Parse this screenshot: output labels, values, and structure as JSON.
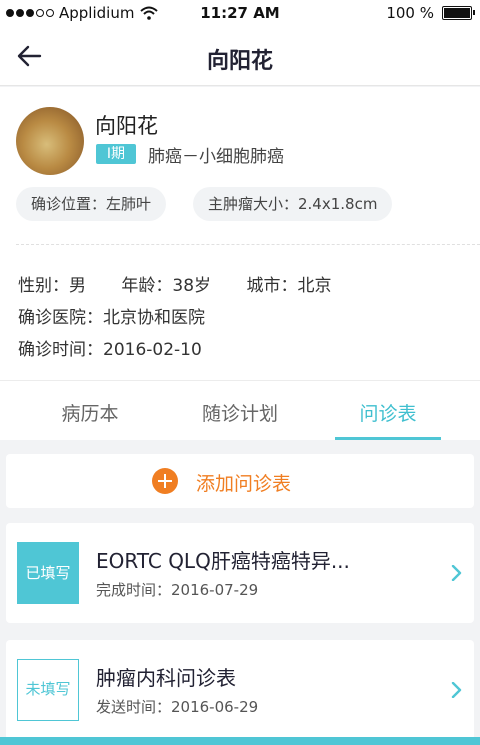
{
  "status": {
    "carrier": "Applidium",
    "time": "11:27 AM",
    "battery": "100 %"
  },
  "nav": {
    "title": "向阳花"
  },
  "patient": {
    "name": "向阳花",
    "stage": "I期",
    "diagnosis": "肺癌－小细胞肺癌",
    "chips": [
      "确诊位置：左肺叶",
      "主肿瘤大小：2.4x1.8cm"
    ],
    "gender": "性别：男",
    "age": "年龄：38岁",
    "city": "城市：北京",
    "hospital": "确诊医院：北京协和医院",
    "diag_time": "确诊时间：2016-02-10"
  },
  "tabs": [
    "病历本",
    "随诊计划",
    "问诊表"
  ],
  "add_label": "添加问诊表",
  "forms": [
    {
      "badge": "已填写",
      "title": "EORTC QLQ肝癌特癌特异...",
      "date": "完成时间：2016-07-29"
    },
    {
      "badge": "未填写",
      "title": "肿瘤内科问诊表",
      "date": "发送时间：2016-06-29"
    }
  ],
  "colors": {
    "accent": "#4fc6d5",
    "add": "#f07e22"
  }
}
